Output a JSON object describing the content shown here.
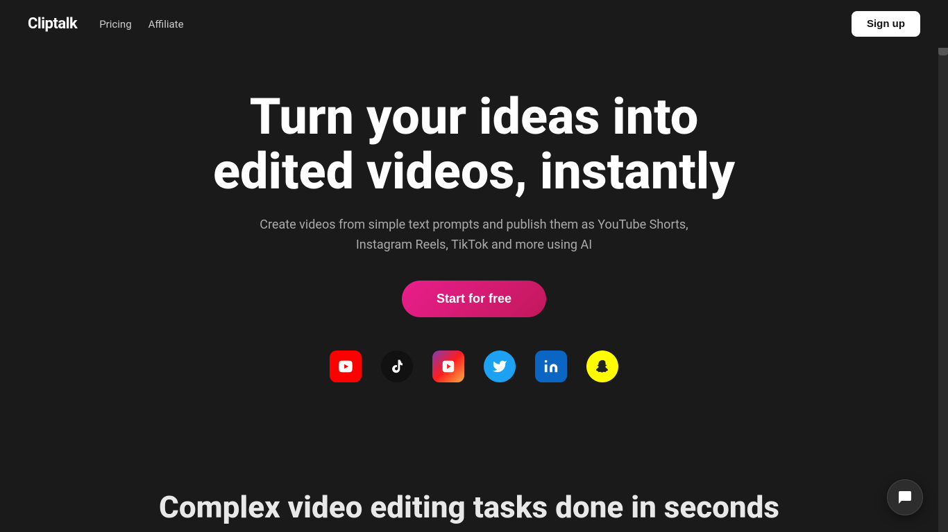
{
  "navbar": {
    "logo": "Cliptalk",
    "links": [
      {
        "label": "Pricing",
        "id": "pricing"
      },
      {
        "label": "Affiliate",
        "id": "affiliate"
      }
    ],
    "signup_label": "Sign up"
  },
  "hero": {
    "title": "Turn your ideas into edited videos, instantly",
    "subtitle": "Create videos from simple text prompts and publish them as YouTube Shorts, Instagram Reels, TikTok and more using AI",
    "cta_label": "Start for free"
  },
  "social_icons": [
    {
      "name": "youtube-icon",
      "label": "YouTube",
      "symbol": "▶",
      "class": "icon-youtube"
    },
    {
      "name": "tiktok-icon",
      "label": "TikTok",
      "symbol": "♪",
      "class": "icon-tiktok"
    },
    {
      "name": "instagram-tv-icon",
      "label": "Instagram TV",
      "symbol": "▶",
      "class": "icon-instagram-tv"
    },
    {
      "name": "twitter-icon",
      "label": "Twitter",
      "symbol": "🐦",
      "class": "icon-twitter"
    },
    {
      "name": "linkedin-icon",
      "label": "LinkedIn",
      "symbol": "in",
      "class": "icon-linkedin"
    },
    {
      "name": "snapchat-icon",
      "label": "Snapchat",
      "symbol": "👻",
      "class": "icon-snapchat"
    }
  ],
  "bottom": {
    "title": "Complex video editing tasks done in seconds"
  },
  "chat": {
    "label": "Chat support"
  },
  "colors": {
    "background": "#1a1a1a",
    "cta_bg": "#e91e8c",
    "text_primary": "#ffffff",
    "text_secondary": "#aaaaaa"
  }
}
